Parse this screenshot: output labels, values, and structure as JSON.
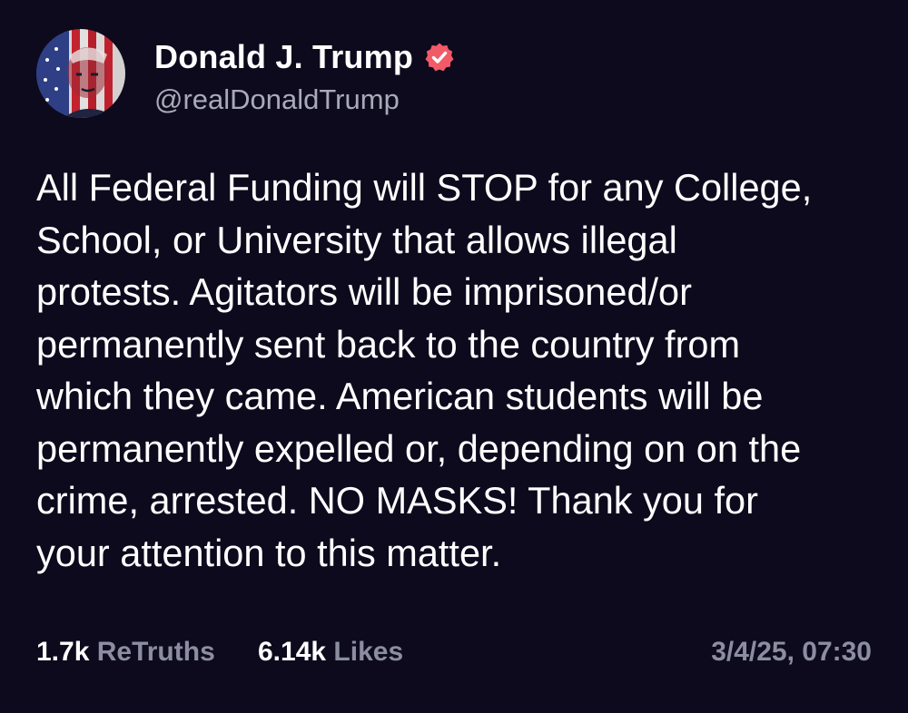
{
  "colors": {
    "background": "#0c0a1c",
    "verified_badge": "#f25a68",
    "muted_text": "#8d8da2"
  },
  "author": {
    "display_name": "Donald J. Trump",
    "handle": "@realDonaldTrump",
    "verified_icon": "verified-badge-icon",
    "avatar_icon": "flag-portrait-avatar"
  },
  "post": {
    "body": "All Federal Funding will STOP for any College,\nSchool, or University that allows illegal\nprotests. Agitators will be imprisoned/or\npermanently sent back to the country from\nwhich they came. American students will be\npermanently expelled or, depending on on the\ncrime, arrested. NO MASKS! Thank you for\nyour attention to this matter."
  },
  "stats": {
    "retruths_count": "1.7k",
    "retruths_label": "ReTruths",
    "likes_count": "6.14k",
    "likes_label": "Likes"
  },
  "timestamp": "3/4/25, 07:30"
}
